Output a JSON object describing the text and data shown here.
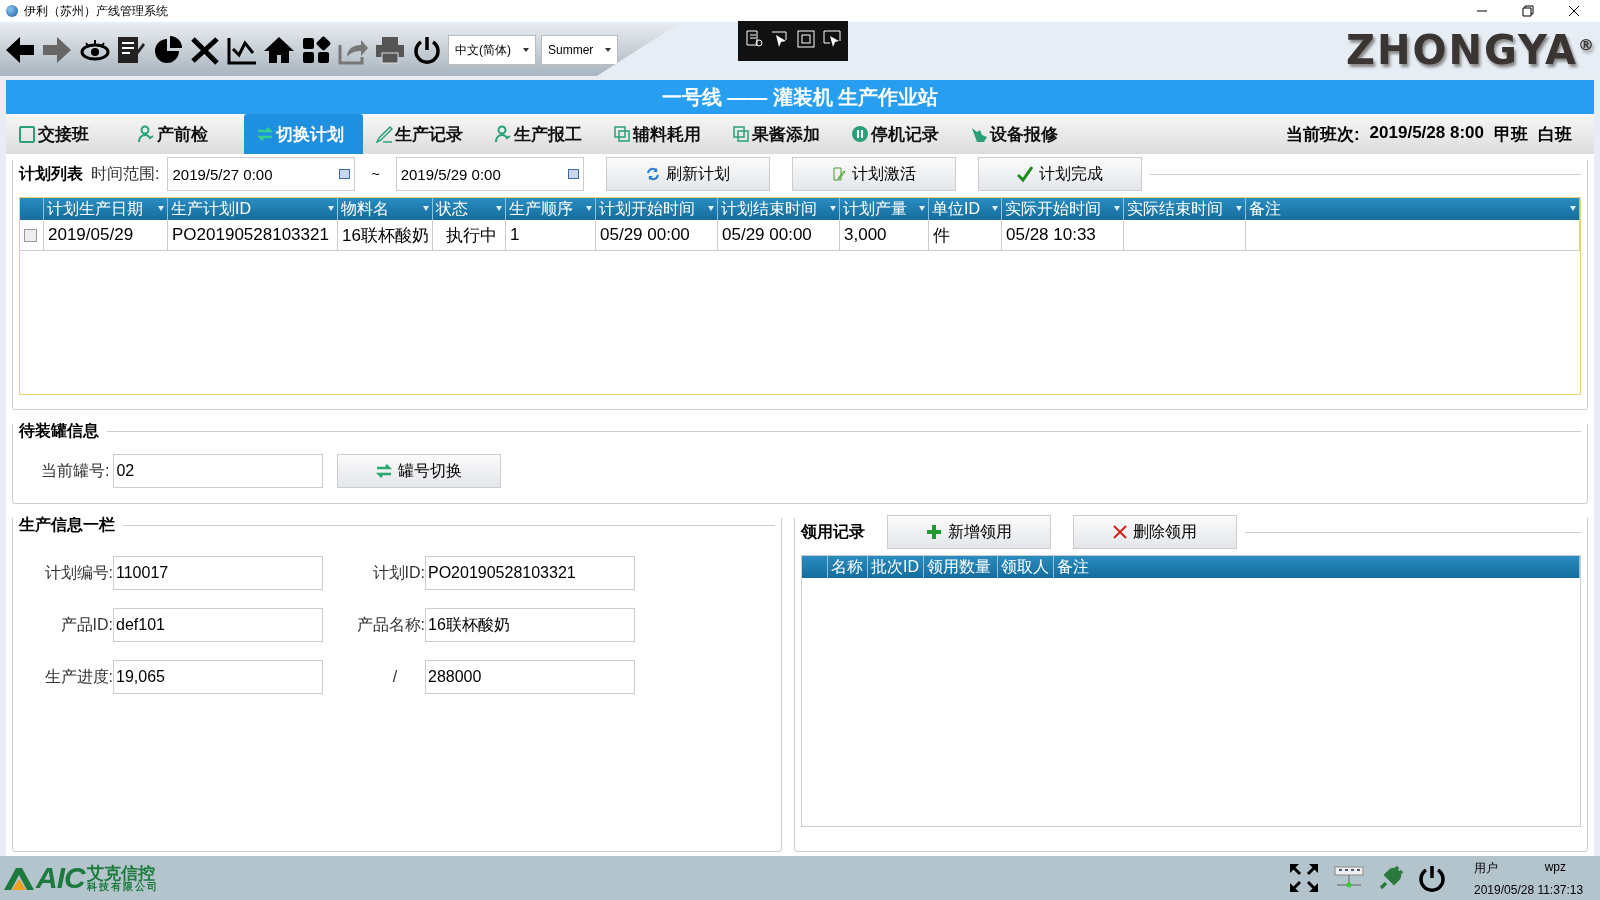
{
  "window": {
    "title": "伊利（苏州）产线管理系统"
  },
  "toolbar": {
    "language": "中文(简体)",
    "theme": "Summer",
    "logo": "ZHONGYA",
    "logo_mark": "®"
  },
  "header": {
    "title": "一号线 —— 灌装机 生产作业站"
  },
  "tabs": [
    {
      "label": "交接班",
      "selected": false
    },
    {
      "label": "产前检",
      "selected": false
    },
    {
      "label": "切换计划",
      "selected": true
    },
    {
      "label": "生产记录",
      "selected": false
    },
    {
      "label": "生产报工",
      "selected": false
    },
    {
      "label": "辅料耗用",
      "selected": false
    },
    {
      "label": "果酱添加",
      "selected": false
    },
    {
      "label": "停机记录",
      "selected": false
    },
    {
      "label": "设备报修",
      "selected": false
    }
  ],
  "shift": {
    "label": "当前班次:",
    "value": "2019/5/28 8:00",
    "team": "甲班",
    "period": "白班"
  },
  "plan_list": {
    "title": "计划列表",
    "range_label": "时间范围:",
    "from": "2019/5/27 0:00",
    "separator": "~",
    "to": "2019/5/29 0:00",
    "buttons": [
      "刷新计划",
      "计划激活",
      "计划完成"
    ],
    "columns": [
      "计划生产日期",
      "生产计划ID",
      "物料名",
      "状态",
      "生产顺序",
      "计划开始时间",
      "计划结束时间",
      "计划产量",
      "单位ID",
      "实际开始时间",
      "实际结束时间",
      "备注"
    ],
    "rows": [
      {
        "checked": false,
        "cells": [
          "2019/05/29",
          "PO20190528103321",
          "16联杯酸奶",
          "执行中",
          "1",
          "05/29 00:00",
          "05/29 00:00",
          "3,000",
          "件",
          "05/28 10:33",
          "",
          ""
        ]
      }
    ]
  },
  "tank": {
    "title": "待装罐信息",
    "label": "当前罐号:",
    "value": "02",
    "button": "罐号切换"
  },
  "production": {
    "title": "生产信息一栏",
    "fields": [
      {
        "label": "计划编号:",
        "value": "110017"
      },
      {
        "label": "计划ID:",
        "value": "PO20190528103321"
      },
      {
        "label": "产品ID:",
        "value": "def101"
      },
      {
        "label": "产品名称:",
        "value": "16联杯酸奶"
      },
      {
        "label": "生产进度:",
        "value": "19,065"
      },
      {
        "label": "/",
        "value": "288000"
      }
    ]
  },
  "records": {
    "title": "领用记录",
    "buttons": [
      "新增领用",
      "删除领用"
    ],
    "columns": [
      "名称",
      "批次ID",
      "领用数量",
      "领取人",
      "备注"
    ]
  },
  "status_bar": {
    "logo": "AIC",
    "company": "艾克信控",
    "company_sub": "科技有限公司",
    "user_label": "用户",
    "user": "wpz",
    "datetime": "2019/05/28 11:37:13"
  }
}
